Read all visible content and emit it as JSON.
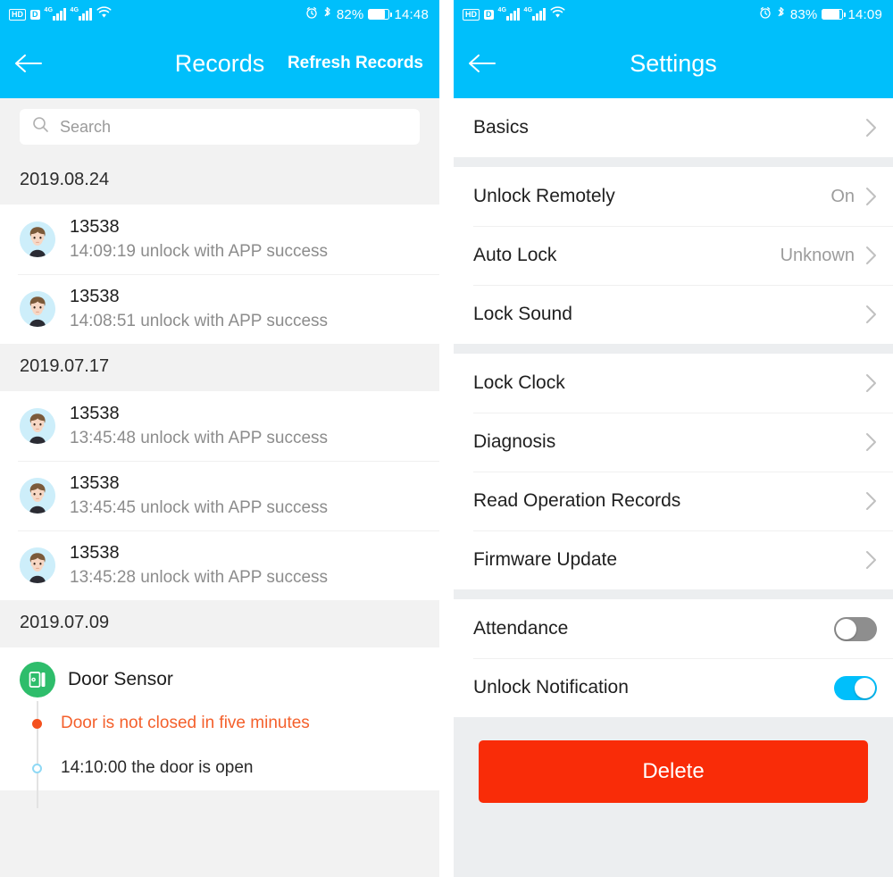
{
  "records_screen": {
    "status_bar": {
      "hd_label": "HD",
      "data_label": "D",
      "network_label": "4G",
      "battery_percent": "82%",
      "time": "14:48"
    },
    "nav": {
      "title": "Records",
      "action_label": "Refresh Records"
    },
    "search": {
      "placeholder": "Search"
    },
    "sections": [
      {
        "date": "2019.08.24",
        "entries": [
          {
            "name": "13538",
            "detail": "14:09:19 unlock with APP success"
          },
          {
            "name": "13538",
            "detail": "14:08:51 unlock with APP success"
          }
        ]
      },
      {
        "date": "2019.07.17",
        "entries": [
          {
            "name": "13538",
            "detail": "13:45:48 unlock with APP success"
          },
          {
            "name": "13538",
            "detail": "13:45:45 unlock with APP success"
          },
          {
            "name": "13538",
            "detail": "13:45:28 unlock with APP success"
          }
        ]
      }
    ],
    "sensor_section": {
      "date": "2019.07.09",
      "device_name": "Door Sensor",
      "events": [
        {
          "text": "Door is not closed in five minutes",
          "type": "alert"
        },
        {
          "text": "14:10:00 the door is open",
          "type": "normal"
        }
      ]
    }
  },
  "settings_screen": {
    "status_bar": {
      "hd_label": "HD",
      "data_label": "D",
      "network_label": "4G",
      "battery_percent": "83%",
      "time": "14:09"
    },
    "nav": {
      "title": "Settings"
    },
    "groups": [
      {
        "rows": [
          {
            "label": "Basics",
            "value": "",
            "control": "chevron"
          }
        ]
      },
      {
        "rows": [
          {
            "label": "Unlock Remotely",
            "value": "On",
            "control": "chevron"
          },
          {
            "label": "Auto Lock",
            "value": "Unknown",
            "control": "chevron"
          },
          {
            "label": "Lock Sound",
            "value": "",
            "control": "chevron"
          }
        ]
      },
      {
        "rows": [
          {
            "label": "Lock Clock",
            "value": "",
            "control": "chevron"
          },
          {
            "label": "Diagnosis",
            "value": "",
            "control": "chevron"
          },
          {
            "label": "Read Operation Records",
            "value": "",
            "control": "chevron"
          },
          {
            "label": "Firmware Update",
            "value": "",
            "control": "chevron"
          }
        ]
      },
      {
        "rows": [
          {
            "label": "Attendance",
            "value": "",
            "control": "toggle-off"
          },
          {
            "label": "Unlock Notification",
            "value": "",
            "control": "toggle-on"
          }
        ]
      }
    ],
    "delete_label": "Delete"
  },
  "colors": {
    "accent_blue": "#00bffb",
    "delete_red": "#f92c08",
    "alert_orange": "#f4602c",
    "sensor_green": "#2ebd6b"
  }
}
